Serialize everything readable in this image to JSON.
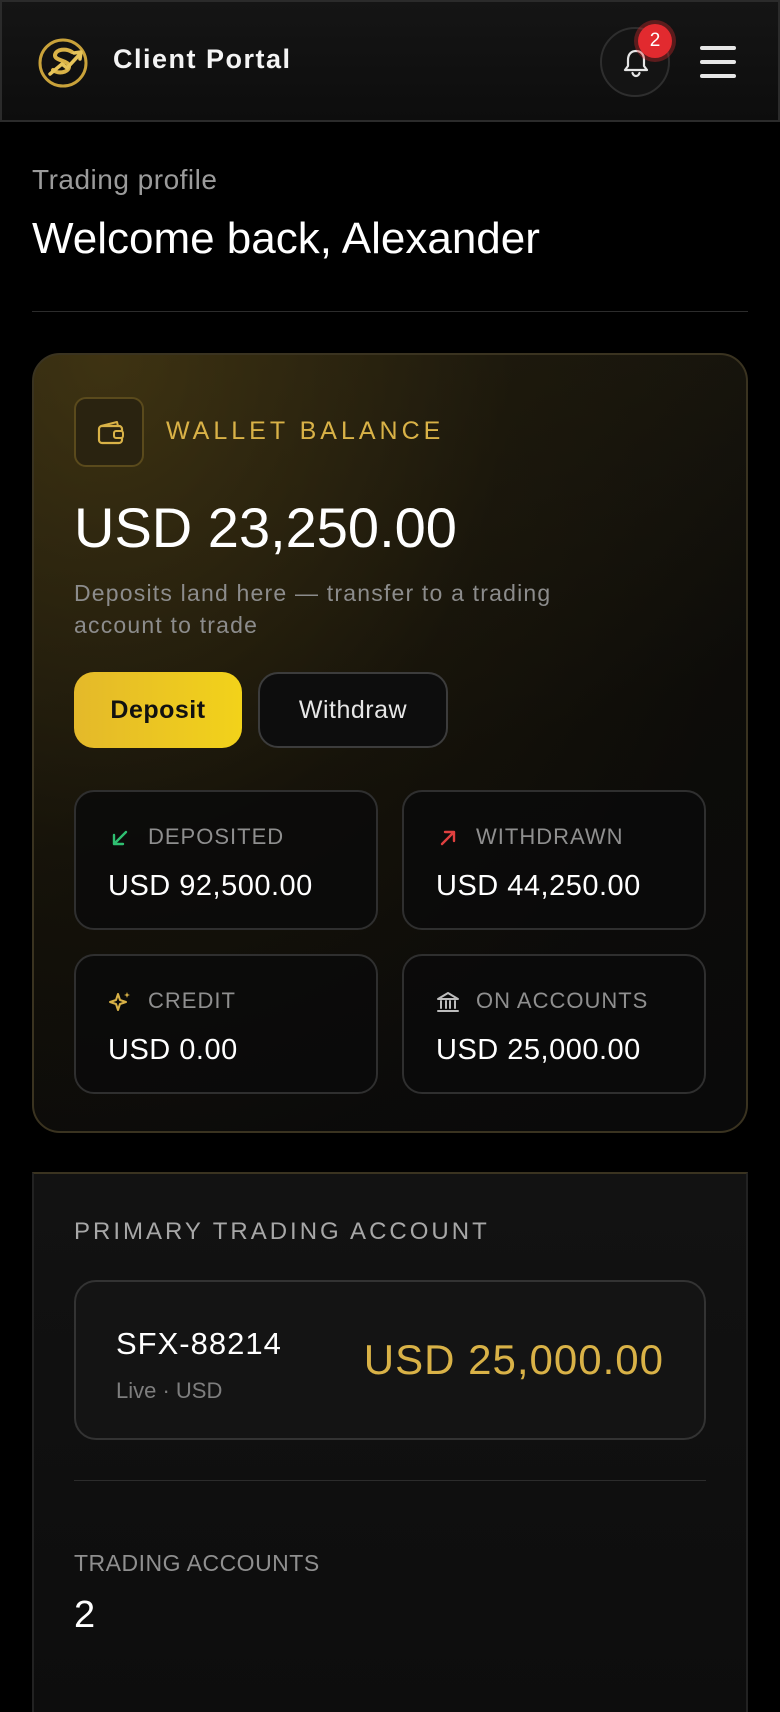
{
  "header": {
    "title": "Client Portal",
    "notification_count": "2",
    "logo_icon": "logo-icon",
    "bell_icon": "bell-icon",
    "menu_icon": "hamburger-menu-icon"
  },
  "profile": {
    "subtitle": "Trading profile",
    "welcome": "Welcome back, Alexander"
  },
  "wallet": {
    "label": "WALLET BALANCE",
    "amount": "USD 23,250.00",
    "note": "Deposits land here — transfer to a trading account to trade",
    "deposit_label": "Deposit",
    "withdraw_label": "Withdraw",
    "stats": [
      {
        "label": "DEPOSITED",
        "value": "USD 92,500.00",
        "icon": "arrow-down-left-icon",
        "color": "#2fbf71"
      },
      {
        "label": "WITHDRAWN",
        "value": "USD 44,250.00",
        "icon": "arrow-up-right-icon",
        "color": "#e0403f"
      },
      {
        "label": "CREDIT",
        "value": "USD 0.00",
        "icon": "sparkles-icon",
        "color": "#d9b247"
      },
      {
        "label": "ON ACCOUNTS",
        "value": "USD 25,000.00",
        "icon": "bank-icon",
        "color": "#bdbdbd"
      }
    ]
  },
  "primary_account": {
    "label": "PRIMARY TRADING ACCOUNT",
    "id": "SFX-88214",
    "type": "Live · USD",
    "balance": "USD 25,000.00"
  },
  "trading_accounts": {
    "label": "TRADING ACCOUNTS",
    "count": "2"
  },
  "colors": {
    "accent_gold": "#d9b247",
    "button_yellow": "#f2d21a",
    "badge_red": "#e22a2f"
  }
}
